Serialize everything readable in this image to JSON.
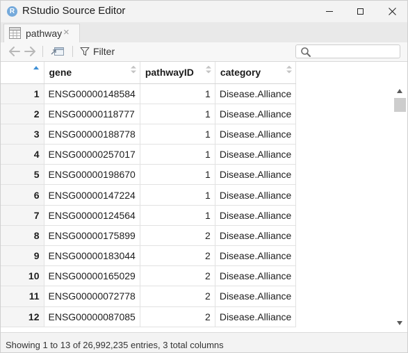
{
  "window": {
    "title": "RStudio Source Editor",
    "app_icon_letter": "R"
  },
  "tab": {
    "label": "pathway",
    "close_glyph": "×"
  },
  "toolbar": {
    "filter_label": "Filter",
    "search_placeholder": ""
  },
  "table": {
    "columns": [
      "gene",
      "pathwayID",
      "category"
    ],
    "rows": [
      {
        "index": "1",
        "gene": "ENSG00000148584",
        "pathwayID": "1",
        "category": "Disease.Alliance"
      },
      {
        "index": "2",
        "gene": "ENSG00000118777",
        "pathwayID": "1",
        "category": "Disease.Alliance"
      },
      {
        "index": "3",
        "gene": "ENSG00000188778",
        "pathwayID": "1",
        "category": "Disease.Alliance"
      },
      {
        "index": "4",
        "gene": "ENSG00000257017",
        "pathwayID": "1",
        "category": "Disease.Alliance"
      },
      {
        "index": "5",
        "gene": "ENSG00000198670",
        "pathwayID": "1",
        "category": "Disease.Alliance"
      },
      {
        "index": "6",
        "gene": "ENSG00000147224",
        "pathwayID": "1",
        "category": "Disease.Alliance"
      },
      {
        "index": "7",
        "gene": "ENSG00000124564",
        "pathwayID": "1",
        "category": "Disease.Alliance"
      },
      {
        "index": "8",
        "gene": "ENSG00000175899",
        "pathwayID": "2",
        "category": "Disease.Alliance"
      },
      {
        "index": "9",
        "gene": "ENSG00000183044",
        "pathwayID": "2",
        "category": "Disease.Alliance"
      },
      {
        "index": "10",
        "gene": "ENSG00000165029",
        "pathwayID": "2",
        "category": "Disease.Alliance"
      },
      {
        "index": "11",
        "gene": "ENSG00000072778",
        "pathwayID": "2",
        "category": "Disease.Alliance"
      },
      {
        "index": "12",
        "gene": "ENSG00000087085",
        "pathwayID": "2",
        "category": "Disease.Alliance"
      }
    ]
  },
  "status": {
    "text": "Showing 1 to 13 of 26,992,235 entries, 3 total columns"
  },
  "colors": {
    "sort_accent": "#3d8fd6",
    "app_icon": "#75aadb"
  },
  "icons": {
    "app": "r-logo-icon",
    "tab": "data-grid-icon",
    "back": "arrow-left-icon",
    "forward": "arrow-right-icon",
    "popout": "popout-window-icon",
    "filter": "filter-funnel-icon",
    "search": "search-icon"
  }
}
